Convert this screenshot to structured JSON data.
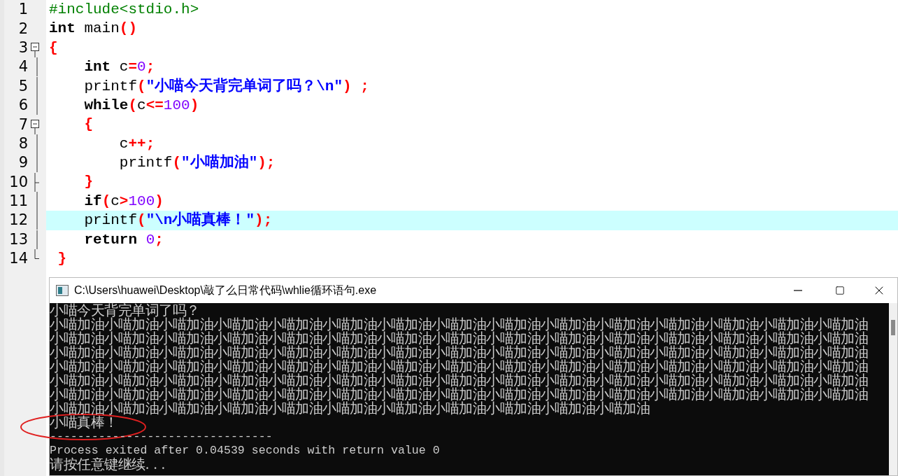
{
  "editor": {
    "lines": [
      {
        "number": "1",
        "highlighted": false,
        "tokens": [
          {
            "kind": "preproc",
            "text": "#include<stdio.h>"
          }
        ]
      },
      {
        "number": "2",
        "highlighted": false,
        "tokens": [
          {
            "kind": "keyword",
            "text": "int"
          },
          {
            "kind": "plain",
            "text": " main"
          },
          {
            "kind": "symbol",
            "text": "()"
          }
        ]
      },
      {
        "number": "3",
        "kind": "start",
        "highlighted": false,
        "tokens": [
          {
            "kind": "symbol",
            "text": "{"
          }
        ]
      },
      {
        "number": "4",
        "kind": "line",
        "highlighted": false,
        "tokens": [
          {
            "kind": "keyword",
            "text": "    int"
          },
          {
            "kind": "plain",
            "text": " c"
          },
          {
            "kind": "symbol",
            "text": "="
          },
          {
            "kind": "number",
            "text": "0"
          },
          {
            "kind": "symbol",
            "text": ";"
          }
        ]
      },
      {
        "number": "5",
        "kind": "line",
        "highlighted": false,
        "tokens": [
          {
            "kind": "plain",
            "text": "    printf"
          },
          {
            "kind": "symbol",
            "text": "("
          },
          {
            "kind": "string",
            "text": "\"小喵今天背完单词了吗？\\n\""
          },
          {
            "kind": "symbol",
            "text": ") ;"
          }
        ]
      },
      {
        "number": "6",
        "kind": "line",
        "highlighted": false,
        "tokens": [
          {
            "kind": "keyword",
            "text": "    while"
          },
          {
            "kind": "symbol",
            "text": "("
          },
          {
            "kind": "plain",
            "text": "c"
          },
          {
            "kind": "symbol",
            "text": "<="
          },
          {
            "kind": "number",
            "text": "100"
          },
          {
            "kind": "symbol",
            "text": ")"
          }
        ]
      },
      {
        "number": "7",
        "kind": "start",
        "highlighted": false,
        "tokens": [
          {
            "kind": "symbol",
            "text": "    {"
          }
        ]
      },
      {
        "number": "8",
        "kind": "line",
        "highlighted": false,
        "tokens": [
          {
            "kind": "plain",
            "text": "        c"
          },
          {
            "kind": "symbol",
            "text": "++;"
          }
        ]
      },
      {
        "number": "9",
        "kind": "line",
        "highlighted": false,
        "tokens": [
          {
            "kind": "plain",
            "text": "        printf"
          },
          {
            "kind": "symbol",
            "text": "("
          },
          {
            "kind": "string",
            "text": "\"小喵加油\""
          },
          {
            "kind": "symbol",
            "text": ");"
          }
        ]
      },
      {
        "number": "10",
        "kind": "branch",
        "highlighted": false,
        "tokens": [
          {
            "kind": "symbol",
            "text": "    }"
          }
        ]
      },
      {
        "number": "11",
        "kind": "line",
        "highlighted": false,
        "tokens": [
          {
            "kind": "keyword",
            "text": "    if"
          },
          {
            "kind": "symbol",
            "text": "("
          },
          {
            "kind": "plain",
            "text": "c"
          },
          {
            "kind": "symbol",
            "text": ">"
          },
          {
            "kind": "number",
            "text": "100"
          },
          {
            "kind": "symbol",
            "text": ")"
          }
        ]
      },
      {
        "number": "12",
        "kind": "line",
        "highlighted": true,
        "tokens": [
          {
            "kind": "plain",
            "text": "    printf"
          },
          {
            "kind": "symbol",
            "text": "("
          },
          {
            "kind": "string",
            "text": "\"\\n小喵真棒！\""
          },
          {
            "kind": "symbol",
            "text": ");"
          }
        ]
      },
      {
        "number": "13",
        "kind": "line",
        "highlighted": false,
        "tokens": [
          {
            "kind": "keyword",
            "text": "    return"
          },
          {
            "kind": "number",
            "text": " 0"
          },
          {
            "kind": "symbol",
            "text": ";"
          }
        ]
      },
      {
        "number": "14",
        "kind": "end",
        "highlighted": false,
        "tokens": [
          {
            "kind": "symbol",
            "text": " }"
          }
        ]
      }
    ]
  },
  "console": {
    "title": "C:\\Users\\huawei\\Desktop\\敲了么日常代码\\whlie循环语句.exe",
    "output": [
      {
        "kind": "cjk",
        "text": "小喵今天背完单词了吗？"
      },
      {
        "kind": "cjk",
        "text": "小喵加油小喵加油小喵加油小喵加油小喵加油小喵加油小喵加油小喵加油小喵加油小喵加油小喵加油小喵加油小喵加油小喵加油小喵加油"
      },
      {
        "kind": "cjk",
        "text": "小喵加油小喵加油小喵加油小喵加油小喵加油小喵加油小喵加油小喵加油小喵加油小喵加油小喵加油小喵加油小喵加油小喵加油小喵加油"
      },
      {
        "kind": "cjk",
        "text": "小喵加油小喵加油小喵加油小喵加油小喵加油小喵加油小喵加油小喵加油小喵加油小喵加油小喵加油小喵加油小喵加油小喵加油小喵加油"
      },
      {
        "kind": "cjk",
        "text": "小喵加油小喵加油小喵加油小喵加油小喵加油小喵加油小喵加油小喵加油小喵加油小喵加油小喵加油小喵加油小喵加油小喵加油小喵加油"
      },
      {
        "kind": "cjk",
        "text": "小喵加油小喵加油小喵加油小喵加油小喵加油小喵加油小喵加油小喵加油小喵加油小喵加油小喵加油小喵加油小喵加油小喵加油小喵加油"
      },
      {
        "kind": "cjk",
        "text": "小喵加油小喵加油小喵加油小喵加油小喵加油小喵加油小喵加油小喵加油小喵加油小喵加油小喵加油小喵加油小喵加油小喵加油小喵加油"
      },
      {
        "kind": "cjk",
        "text": "小喵加油小喵加油小喵加油小喵加油小喵加油小喵加油小喵加油小喵加油小喵加油小喵加油小喵加油"
      },
      {
        "kind": "cjk",
        "text": "小喵真棒！"
      },
      {
        "kind": "latin",
        "text": "--------------------------------"
      },
      {
        "kind": "latin",
        "text": "Process exited after 0.04539 seconds with return value 0"
      },
      {
        "kind": "cjk",
        "text": "请按任意键继续. . ."
      }
    ]
  }
}
